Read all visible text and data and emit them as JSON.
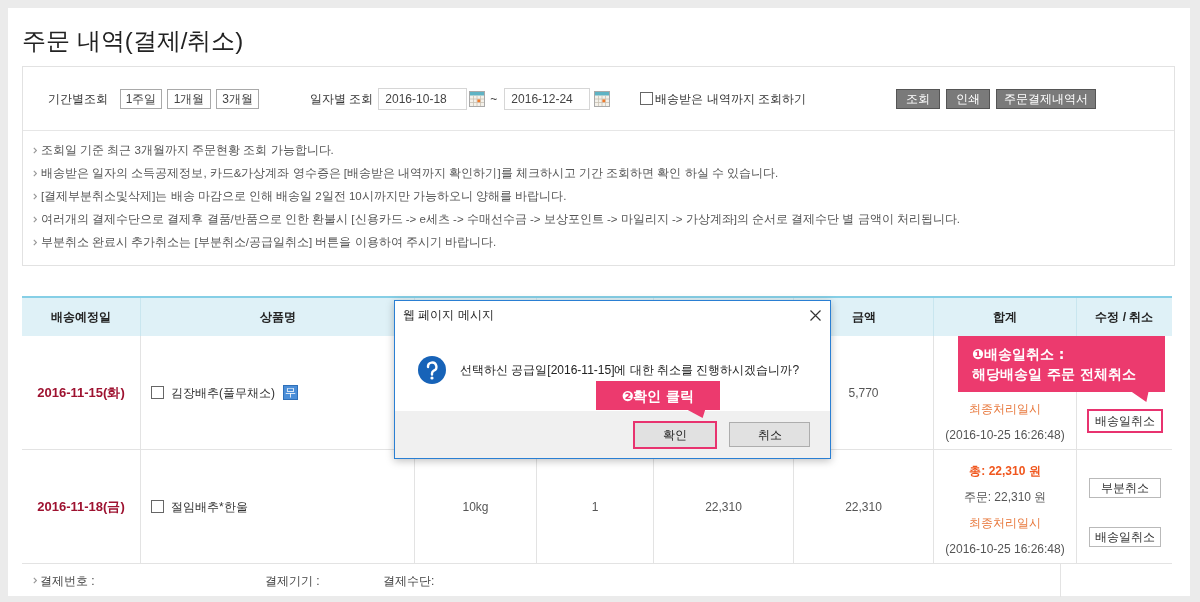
{
  "title": "주문 내역(결제/취소)",
  "filter": {
    "period_label": "기간별조회",
    "period_buttons": [
      "1주일",
      "1개월",
      "3개월"
    ],
    "date_label": "일자별 조회",
    "date_from": "2016-10-18",
    "separator": "~",
    "date_to": "2016-12-24",
    "include_delivered": {
      "label": "배송받은 내역까지 조회하기",
      "checked": false
    },
    "actions": [
      "조회",
      "인쇄",
      "주문결제내역서"
    ]
  },
  "notices": [
    "조회일 기준 최근 3개월까지 주문현황 조회 가능합니다.",
    "배송받은 일자의 소득공제정보, 카드&가상계좌 영수증은 [배송받은 내역까지 확인하기]를 체크하시고 기간 조회하면 확인 하실 수 있습니다.",
    "[결제부분취소및삭제]는 배송 마감으로 인해 배송일 2일전 10시까지만 가능하오니 양해를 바랍니다.",
    "여러개의 결제수단으로 결제후 결품/반품으로 인한 환불시 [신용카드 -> e세츠 -> 수매선수금 -> 보상포인트 -> 마일리지 -> 가상계좌]의 순서로 결제수단 별 금액이 처리됩니다.",
    "부분취소 완료시 추가취소는 [부분취소/공급일취소] 버튼을 이용하여 주시기 바랍니다."
  ],
  "table": {
    "columns": [
      "배송예정일",
      "상품명",
      null,
      null,
      null,
      "금액",
      "합계",
      "수정 / 취소"
    ],
    "rows": [
      {
        "delivery_date": "2016-11-15(화)",
        "product": {
          "name": "김장배추(풀무채소)",
          "checked": false,
          "tag": "무"
        },
        "amount": "5,770",
        "summary": {
          "processed_label": "최종처리일시",
          "processed_at": "(2016-10-25 16:26:48)"
        },
        "actions": [
          {
            "label": "배송일취소",
            "highlighted": true
          }
        ]
      },
      {
        "delivery_date": "2016-11-18(금)",
        "product": {
          "name": "절임배추*한울",
          "checked": false
        },
        "weight": "10kg",
        "quantity": "1",
        "price": "22,310",
        "amount": "22,310",
        "summary": {
          "total": "총: 22,310 원",
          "order": "주문: 22,310 원",
          "processed_label": "최종처리일시",
          "processed_at": "(2016-10-25 16:26:48)"
        },
        "actions": [
          {
            "label": "부분취소",
            "highlighted": false
          },
          {
            "label": "배송일취소",
            "highlighted": false
          }
        ]
      }
    ],
    "footer": [
      "결제번호 :",
      "결제기기 :",
      "결제수단:"
    ]
  },
  "dialog": {
    "title": "웹 페이지 메시지",
    "message": "선택하신 공급일[2016-11-15]에 대한 취소를 진행하시겠습니까?",
    "buttons": [
      {
        "label": "확인",
        "highlighted": true
      },
      {
        "label": "취소",
        "highlighted": false
      }
    ]
  },
  "callouts": [
    {
      "text": "❶배송일취소 :\n해당배송일 주문 전체취소"
    },
    {
      "text": "❷확인 클릭"
    }
  ]
}
